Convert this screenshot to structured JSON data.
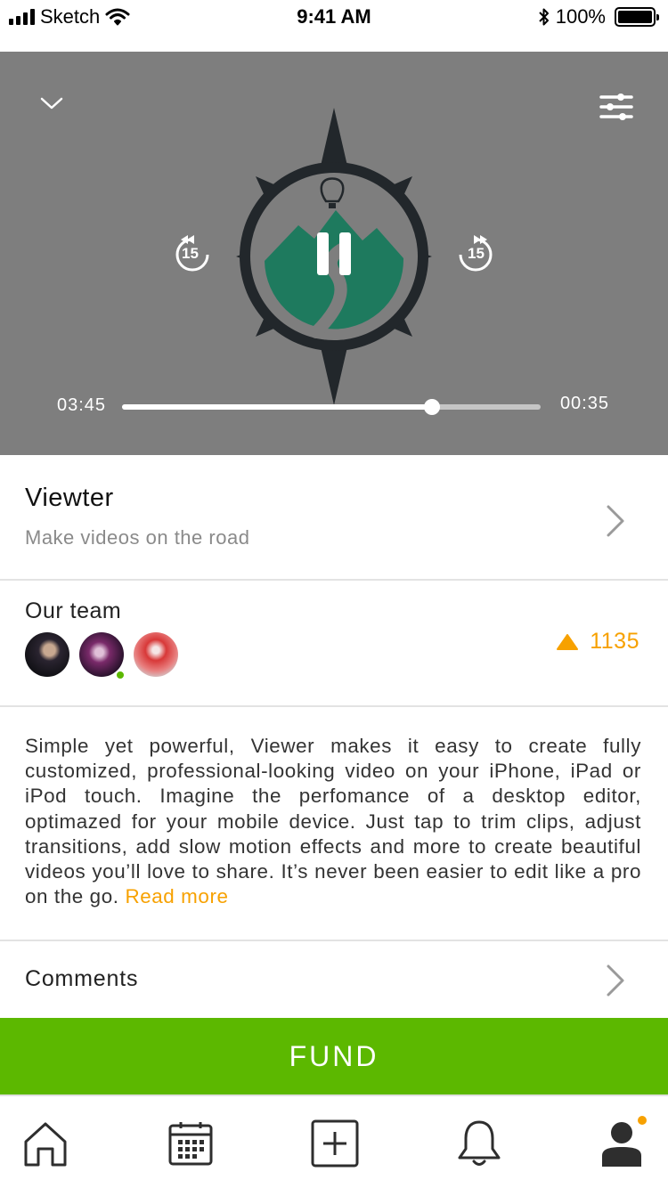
{
  "status_bar": {
    "carrier": "Sketch",
    "time": "9:41 AM",
    "battery_percent": "100%",
    "icons": [
      "signal-icon",
      "wifi-icon",
      "bluetooth-icon",
      "battery-icon"
    ]
  },
  "player": {
    "elapsed": "03:45",
    "remaining": "00:35",
    "progress": 0.74,
    "skip_back_seconds": "15",
    "skip_forward_seconds": "15",
    "icons": [
      "chevron-down-icon",
      "sliders-icon",
      "rewind-15-icon",
      "pause-icon",
      "forward-15-icon"
    ]
  },
  "project": {
    "title": "Viewter",
    "subtitle": "Make videos on the road"
  },
  "team": {
    "heading": "Our team",
    "members": [
      {
        "online": false
      },
      {
        "online": true
      },
      {
        "online": false
      }
    ],
    "upvotes": "1135"
  },
  "description": {
    "text": "Simple yet powerful, Viewer makes it easy to create fully customized, professional-looking video on your iPhone, iPad or iPod touch. Imagine the perfomance of a desktop editor, optimazed for your mobile device. Just tap to trim clips, adjust transitions, add slow motion effects and more to create beautiful videos you’ll love to share. It’s never been easier to edit like a pro on the go.",
    "read_more": "Read more"
  },
  "comments": {
    "label": "Comments"
  },
  "fund_button": {
    "label": "FUND"
  },
  "tab_bar": {
    "tabs": [
      "home-icon",
      "calendar-icon",
      "add-icon",
      "bell-icon",
      "profile-icon"
    ],
    "active": "profile",
    "profile_has_notification": true
  },
  "colors": {
    "accent_green": "#5cb800",
    "accent_orange": "#f7a100",
    "player_bg": "#7e7e7e",
    "logo_teal": "#1e7a5e",
    "compass_dark": "#22272b"
  }
}
